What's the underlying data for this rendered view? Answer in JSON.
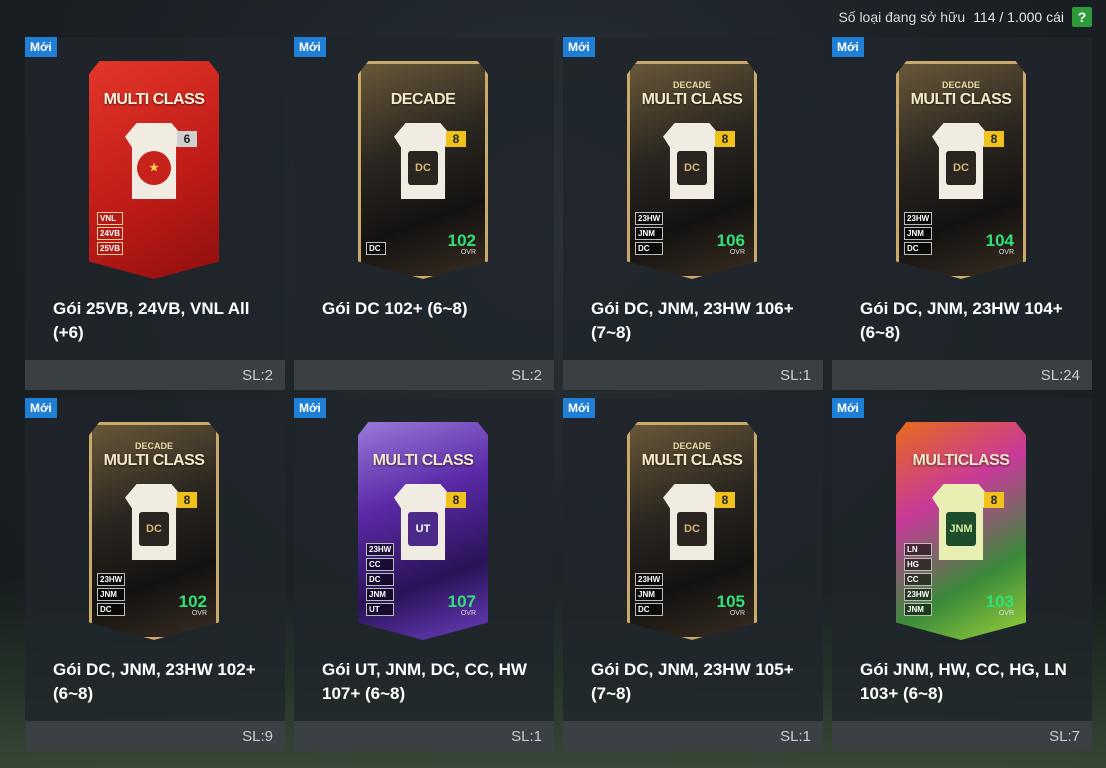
{
  "header": {
    "owned_label": "Số loại đang sở hữu",
    "owned_count": "114 / 1.000 cái",
    "help_icon": "?"
  },
  "new_badge": "Mới",
  "ovr_label": "OVR",
  "packs": [
    {
      "name": "Gói 25VB, 24VB, VNL All (+6)",
      "qty": "SL:2",
      "card_title": "MULTI CLASS",
      "card_sub": "",
      "level": "6",
      "crest": "★",
      "tags": [
        "VNL",
        "24VB",
        "25VB"
      ],
      "ovr": "",
      "style": "red"
    },
    {
      "name": "Gói DC 102+ (6~8)",
      "qty": "SL:2",
      "card_title": "DECADE",
      "card_sub": "",
      "level": "8",
      "crest": "DC",
      "tags": [
        "DC"
      ],
      "ovr": "102",
      "style": "gold"
    },
    {
      "name": "Gói DC, JNM, 23HW 106+ (7~8)",
      "qty": "SL:1",
      "card_title": "MULTI CLASS",
      "card_sub": "DECADE",
      "level": "8",
      "crest": "DC",
      "tags": [
        "23HW",
        "JNM",
        "DC"
      ],
      "ovr": "106",
      "style": "gold"
    },
    {
      "name": "Gói DC, JNM, 23HW 104+ (6~8)",
      "qty": "SL:24",
      "card_title": "MULTI CLASS",
      "card_sub": "DECADE",
      "level": "8",
      "crest": "DC",
      "tags": [
        "23HW",
        "JNM",
        "DC"
      ],
      "ovr": "104",
      "style": "gold"
    },
    {
      "name": "Gói DC, JNM, 23HW 102+ (6~8)",
      "qty": "SL:9",
      "card_title": "MULTI CLASS",
      "card_sub": "DECADE",
      "level": "8",
      "crest": "DC",
      "tags": [
        "23HW",
        "JNM",
        "DC"
      ],
      "ovr": "102",
      "style": "gold"
    },
    {
      "name": "Gói UT, JNM, DC, CC, HW 107+ (6~8)",
      "qty": "SL:1",
      "card_title": "MULTI CLASS",
      "card_sub": "",
      "level": "8",
      "crest": "UT",
      "tags": [
        "23HW",
        "CC",
        "DC",
        "JNM",
        "UT"
      ],
      "ovr": "107",
      "style": "purple"
    },
    {
      "name": "Gói DC, JNM, 23HW 105+ (7~8)",
      "qty": "SL:1",
      "card_title": "MULTI CLASS",
      "card_sub": "DECADE",
      "level": "8",
      "crest": "DC",
      "tags": [
        "23HW",
        "JNM",
        "DC"
      ],
      "ovr": "105",
      "style": "gold"
    },
    {
      "name": "Gói JNM, HW, CC, HG, LN 103+ (6~8)",
      "qty": "SL:7",
      "card_title": "MULTICLASS",
      "card_sub": "",
      "level": "8",
      "crest": "JNM",
      "tags": [
        "LN",
        "HG",
        "CC",
        "23HW",
        "JNM"
      ],
      "ovr": "103",
      "style": "neon"
    }
  ]
}
